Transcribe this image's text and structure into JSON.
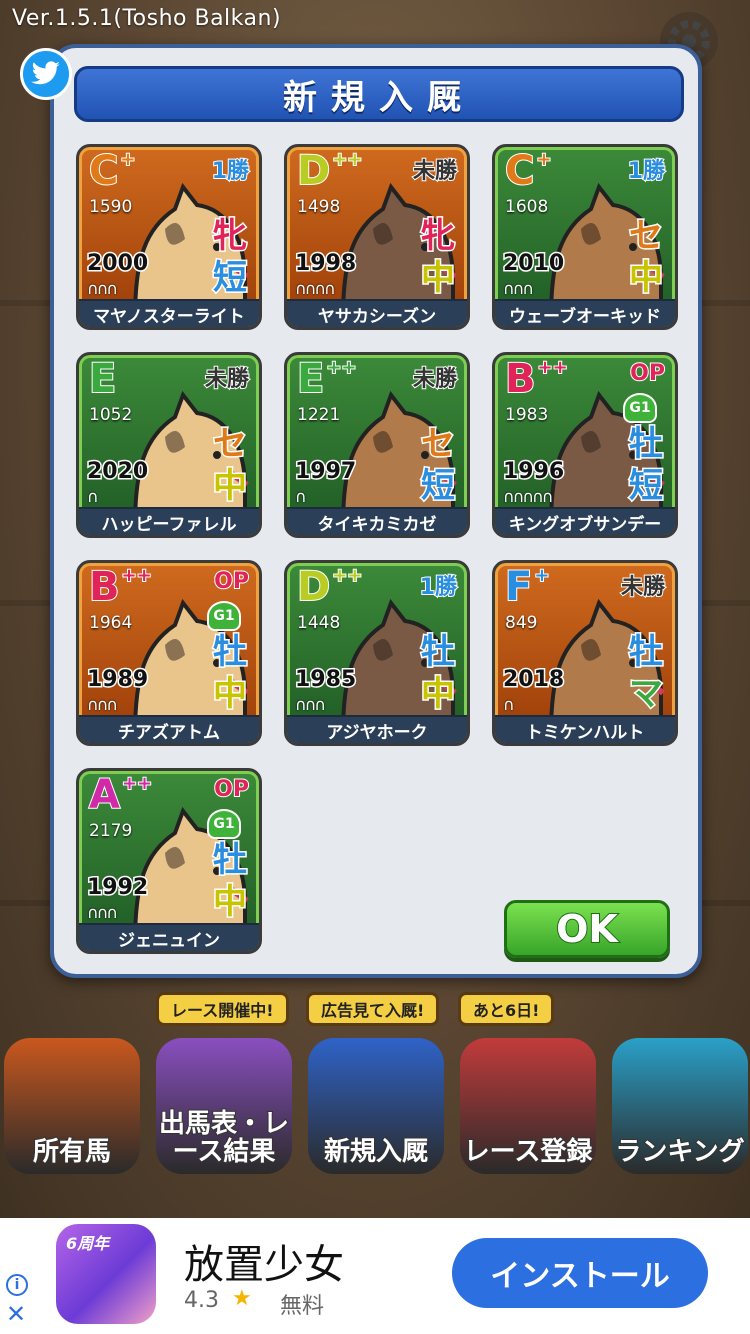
{
  "app": {
    "version": "Ver.1.5.1(Tosho Balkan)"
  },
  "modal": {
    "title": "新規入厩",
    "ok_label": "OK",
    "horses": [
      {
        "rank": "C",
        "rank_plus": "+",
        "rating": "1590",
        "wins": "1勝",
        "g1": "",
        "sex": "牝",
        "distance": "短",
        "year": "2000",
        "shoes": "∩∩∩",
        "name": "マヤノスターライト",
        "theme": "orange",
        "rank_color": "C",
        "wins_color": "blue",
        "sex_color": "red",
        "dist_color": "blue"
      },
      {
        "rank": "D",
        "rank_plus": "++",
        "rating": "1498",
        "wins": "未勝",
        "g1": "",
        "sex": "牝",
        "distance": "中",
        "year": "1998",
        "shoes": "∩∩∩∩",
        "name": "ヤサカシーズン",
        "theme": "orange",
        "rank_color": "D",
        "wins_color": "black",
        "sex_color": "red",
        "dist_color": "yellow"
      },
      {
        "rank": "C",
        "rank_plus": "+",
        "rating": "1608",
        "wins": "1勝",
        "g1": "",
        "sex": "セ",
        "distance": "中",
        "year": "2010",
        "shoes": "∩∩∩",
        "name": "ウェーブオーキッド",
        "theme": "green",
        "rank_color": "C",
        "wins_color": "blue",
        "sex_color": "orange",
        "dist_color": "yellow"
      },
      {
        "rank": "E",
        "rank_plus": "",
        "rating": "1052",
        "wins": "未勝",
        "g1": "",
        "sex": "セ",
        "distance": "中",
        "year": "2020",
        "shoes": "∩",
        "name": "ハッピーファレル",
        "theme": "green",
        "rank_color": "E",
        "wins_color": "black",
        "sex_color": "orange",
        "dist_color": "yellow"
      },
      {
        "rank": "E",
        "rank_plus": "++",
        "rating": "1221",
        "wins": "未勝",
        "g1": "",
        "sex": "セ",
        "distance": "短",
        "year": "1997",
        "shoes": "∩",
        "name": "タイキカミカゼ",
        "theme": "green",
        "rank_color": "E",
        "wins_color": "black",
        "sex_color": "orange",
        "dist_color": "blue"
      },
      {
        "rank": "B",
        "rank_plus": "++",
        "rating": "1983",
        "wins": "OP",
        "g1": "G1",
        "sex": "牡",
        "distance": "短",
        "year": "1996",
        "shoes": "∩∩∩∩∩",
        "name": "キングオブサンデー",
        "theme": "green",
        "rank_color": "B",
        "wins_color": "red",
        "sex_color": "blue",
        "dist_color": "blue"
      },
      {
        "rank": "B",
        "rank_plus": "++",
        "rating": "1964",
        "wins": "OP",
        "g1": "G1",
        "sex": "牡",
        "distance": "中",
        "year": "1989",
        "shoes": "∩∩∩",
        "name": "チアズアトム",
        "theme": "orange",
        "rank_color": "B",
        "wins_color": "red",
        "sex_color": "blue",
        "dist_color": "yellow"
      },
      {
        "rank": "D",
        "rank_plus": "++",
        "rating": "1448",
        "wins": "1勝",
        "g1": "",
        "sex": "牡",
        "distance": "中",
        "year": "1985",
        "shoes": "∩∩∩",
        "name": "アジヤホーク",
        "theme": "green",
        "rank_color": "D",
        "wins_color": "blue",
        "sex_color": "blue",
        "dist_color": "yellow"
      },
      {
        "rank": "F",
        "rank_plus": "+",
        "rating": "849",
        "wins": "未勝",
        "g1": "",
        "sex": "牡",
        "distance": "マ",
        "year": "2018",
        "shoes": "∩",
        "name": "トミケンハルト",
        "theme": "orange",
        "rank_color": "F",
        "wins_color": "black",
        "sex_color": "blue",
        "dist_color": "green"
      },
      {
        "rank": "A",
        "rank_plus": "++",
        "rating": "2179",
        "wins": "OP",
        "g1": "G1",
        "sex": "牡",
        "distance": "中",
        "year": "1992",
        "shoes": "∩∩∩",
        "name": "ジェニュイン",
        "theme": "green",
        "rank_color": "A",
        "wins_color": "red",
        "sex_color": "blue",
        "dist_color": "yellow"
      }
    ]
  },
  "nav": {
    "bubbles": [
      "レース開催中!",
      "広告見て入厩!",
      "あと6日!"
    ],
    "tiles": [
      {
        "label": "所有馬",
        "color": "#c9581e"
      },
      {
        "label": "出馬表・レース結果",
        "color": "#8a4fc0"
      },
      {
        "label": "新規入厩",
        "color": "#2f63c8"
      },
      {
        "label": "レース登録",
        "color": "#c23b3b"
      },
      {
        "label": "ランキング",
        "color": "#2aa0c8"
      }
    ]
  },
  "ad": {
    "title": "放置少女",
    "rating": "4.3",
    "star": "★",
    "price": "無料",
    "install_label": "インストール",
    "icon_badge": "6周年",
    "info": "i",
    "close": "✕"
  }
}
